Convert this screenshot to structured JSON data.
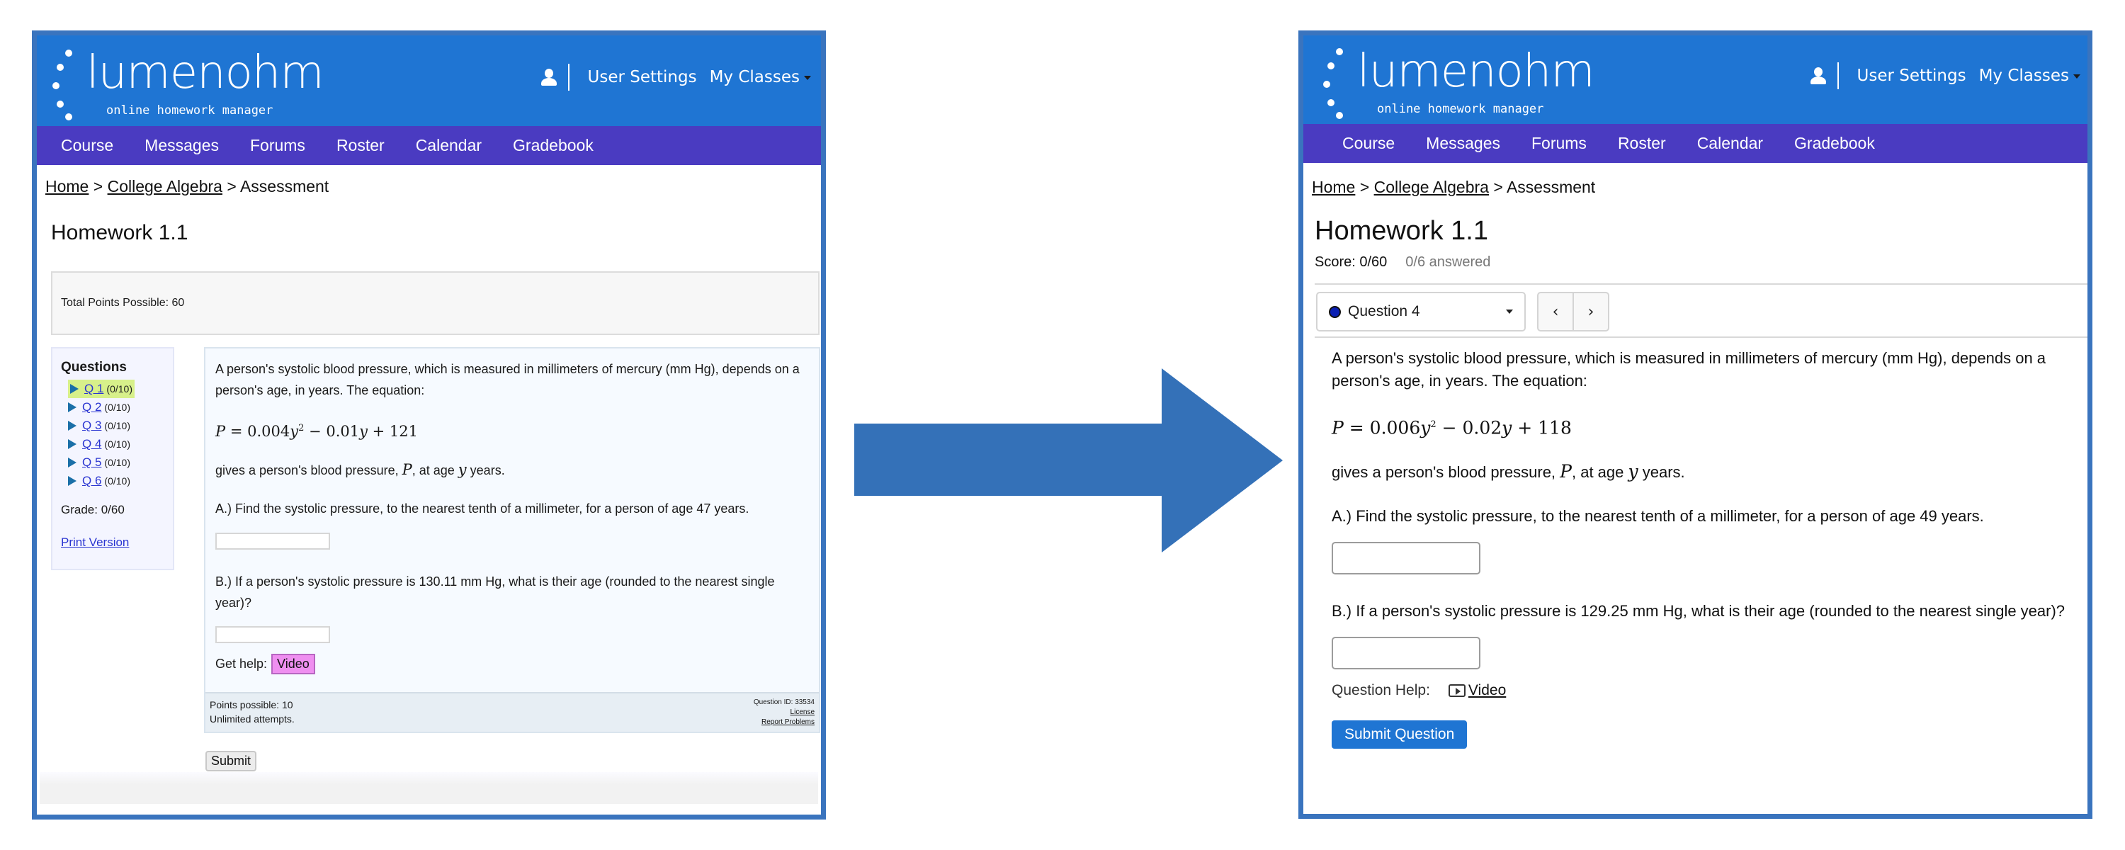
{
  "colors": {
    "header_blue": "#1f75d3",
    "nav_purple": "#4a3bc1",
    "frame_blue": "#3a74be",
    "arrow_blue": "#3471b8",
    "current_question_highlight": "#d7f08a",
    "video_button_old": "#ef8ff0",
    "status_dot": "#0a1fb3"
  },
  "brand": {
    "name_light": "lumen",
    "name_rest": "ohm",
    "tagline": "online homework manager"
  },
  "user_menu": {
    "user_settings": "User Settings",
    "my_classes": "My Classes"
  },
  "nav": [
    "Course",
    "Messages",
    "Forums",
    "Roster",
    "Calendar",
    "Gradebook"
  ],
  "breadcrumb": {
    "home": "Home",
    "sep1": " > ",
    "course": "College Algebra",
    "sep2": " > ",
    "current": "Assessment"
  },
  "old_view": {
    "title": "Homework 1.1",
    "total_points": "Total Points Possible: 60",
    "sidebar": {
      "heading": "Questions",
      "questions": [
        {
          "label": "Q 1",
          "score": "(0/10)",
          "current": true
        },
        {
          "label": "Q 2",
          "score": "(0/10)",
          "current": false
        },
        {
          "label": "Q 3",
          "score": "(0/10)",
          "current": false
        },
        {
          "label": "Q 4",
          "score": "(0/10)",
          "current": false
        },
        {
          "label": "Q 5",
          "score": "(0/10)",
          "current": false
        },
        {
          "label": "Q 6",
          "score": "(0/10)",
          "current": false
        }
      ],
      "grade": "Grade: 0/60",
      "print_version": "Print Version"
    },
    "question": {
      "intro": "A person's systolic blood pressure, which is measured in millimeters of mercury (mm Hg), depends on a person's age, in years. The equation:",
      "equation": {
        "lhs": "P",
        "a": "0.004",
        "b": "0.01",
        "c": "121"
      },
      "gives_prefix": "gives a person's blood pressure, ",
      "gives_var": "P",
      "gives_mid": ", at age ",
      "gives_var2": "y",
      "gives_suffix": " years.",
      "part_a": "A.) Find the systolic pressure, to the nearest tenth of a millimeter, for a person of age 47 years.",
      "part_b": "B.) If a person's systolic pressure is 130.11 mm Hg, what is their age (rounded to the nearest single year)?",
      "help_label": "Get help:",
      "video_label": "Video"
    },
    "footer": {
      "points_possible": "Points possible: 10",
      "attempts": "Unlimited attempts.",
      "question_id": "Question ID: 33534",
      "license": "License",
      "report": "Report Problems"
    },
    "submit_label": "Submit"
  },
  "new_view": {
    "title": "Homework 1.1",
    "score": "Score: 0/60",
    "answered": "0/6 answered",
    "question_select": "Question 4",
    "prev_label": "‹",
    "next_label": "›",
    "question": {
      "intro": "A person's systolic blood pressure, which is measured in millimeters of mercury (mm Hg), depends on a person's age, in years. The equation:",
      "equation": {
        "lhs": "P",
        "a": "0.006",
        "b": "0.02",
        "c": "118"
      },
      "gives_prefix": "gives a person's blood pressure, ",
      "gives_var": "P",
      "gives_mid": ", at age ",
      "gives_var2": "y",
      "gives_suffix": " years.",
      "part_a": "A.) Find the systolic pressure, to the nearest tenth of a millimeter, for a person of age 49 years.",
      "part_b": "B.) If a person's systolic pressure is 129.25 mm Hg, what is their age (rounded to the nearest single year)?",
      "help_label": "Question Help:",
      "video_label": "Video"
    },
    "submit_label": "Submit Question"
  }
}
